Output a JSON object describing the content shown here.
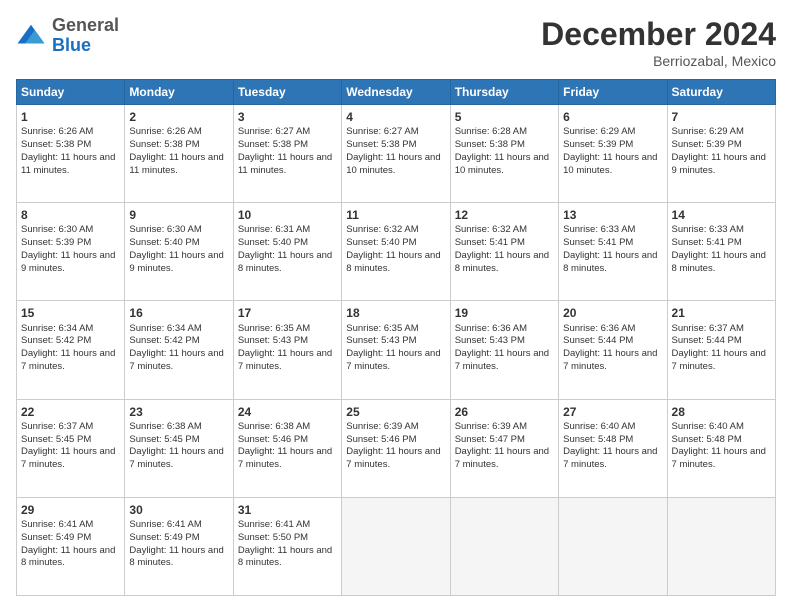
{
  "logo": {
    "general": "General",
    "blue": "Blue"
  },
  "header": {
    "month": "December 2024",
    "location": "Berriozabal, Mexico"
  },
  "weekdays": [
    "Sunday",
    "Monday",
    "Tuesday",
    "Wednesday",
    "Thursday",
    "Friday",
    "Saturday"
  ],
  "weeks": [
    [
      {
        "day": 1,
        "sunrise": "6:26 AM",
        "sunset": "5:38 PM",
        "daylight": "11 hours and 11 minutes."
      },
      {
        "day": 2,
        "sunrise": "6:26 AM",
        "sunset": "5:38 PM",
        "daylight": "11 hours and 11 minutes."
      },
      {
        "day": 3,
        "sunrise": "6:27 AM",
        "sunset": "5:38 PM",
        "daylight": "11 hours and 11 minutes."
      },
      {
        "day": 4,
        "sunrise": "6:27 AM",
        "sunset": "5:38 PM",
        "daylight": "11 hours and 10 minutes."
      },
      {
        "day": 5,
        "sunrise": "6:28 AM",
        "sunset": "5:38 PM",
        "daylight": "11 hours and 10 minutes."
      },
      {
        "day": 6,
        "sunrise": "6:29 AM",
        "sunset": "5:39 PM",
        "daylight": "11 hours and 10 minutes."
      },
      {
        "day": 7,
        "sunrise": "6:29 AM",
        "sunset": "5:39 PM",
        "daylight": "11 hours and 9 minutes."
      }
    ],
    [
      {
        "day": 8,
        "sunrise": "6:30 AM",
        "sunset": "5:39 PM",
        "daylight": "11 hours and 9 minutes."
      },
      {
        "day": 9,
        "sunrise": "6:30 AM",
        "sunset": "5:40 PM",
        "daylight": "11 hours and 9 minutes."
      },
      {
        "day": 10,
        "sunrise": "6:31 AM",
        "sunset": "5:40 PM",
        "daylight": "11 hours and 8 minutes."
      },
      {
        "day": 11,
        "sunrise": "6:32 AM",
        "sunset": "5:40 PM",
        "daylight": "11 hours and 8 minutes."
      },
      {
        "day": 12,
        "sunrise": "6:32 AM",
        "sunset": "5:41 PM",
        "daylight": "11 hours and 8 minutes."
      },
      {
        "day": 13,
        "sunrise": "6:33 AM",
        "sunset": "5:41 PM",
        "daylight": "11 hours and 8 minutes."
      },
      {
        "day": 14,
        "sunrise": "6:33 AM",
        "sunset": "5:41 PM",
        "daylight": "11 hours and 8 minutes."
      }
    ],
    [
      {
        "day": 15,
        "sunrise": "6:34 AM",
        "sunset": "5:42 PM",
        "daylight": "11 hours and 7 minutes."
      },
      {
        "day": 16,
        "sunrise": "6:34 AM",
        "sunset": "5:42 PM",
        "daylight": "11 hours and 7 minutes."
      },
      {
        "day": 17,
        "sunrise": "6:35 AM",
        "sunset": "5:43 PM",
        "daylight": "11 hours and 7 minutes."
      },
      {
        "day": 18,
        "sunrise": "6:35 AM",
        "sunset": "5:43 PM",
        "daylight": "11 hours and 7 minutes."
      },
      {
        "day": 19,
        "sunrise": "6:36 AM",
        "sunset": "5:43 PM",
        "daylight": "11 hours and 7 minutes."
      },
      {
        "day": 20,
        "sunrise": "6:36 AM",
        "sunset": "5:44 PM",
        "daylight": "11 hours and 7 minutes."
      },
      {
        "day": 21,
        "sunrise": "6:37 AM",
        "sunset": "5:44 PM",
        "daylight": "11 hours and 7 minutes."
      }
    ],
    [
      {
        "day": 22,
        "sunrise": "6:37 AM",
        "sunset": "5:45 PM",
        "daylight": "11 hours and 7 minutes."
      },
      {
        "day": 23,
        "sunrise": "6:38 AM",
        "sunset": "5:45 PM",
        "daylight": "11 hours and 7 minutes."
      },
      {
        "day": 24,
        "sunrise": "6:38 AM",
        "sunset": "5:46 PM",
        "daylight": "11 hours and 7 minutes."
      },
      {
        "day": 25,
        "sunrise": "6:39 AM",
        "sunset": "5:46 PM",
        "daylight": "11 hours and 7 minutes."
      },
      {
        "day": 26,
        "sunrise": "6:39 AM",
        "sunset": "5:47 PM",
        "daylight": "11 hours and 7 minutes."
      },
      {
        "day": 27,
        "sunrise": "6:40 AM",
        "sunset": "5:48 PM",
        "daylight": "11 hours and 7 minutes."
      },
      {
        "day": 28,
        "sunrise": "6:40 AM",
        "sunset": "5:48 PM",
        "daylight": "11 hours and 7 minutes."
      }
    ],
    [
      {
        "day": 29,
        "sunrise": "6:41 AM",
        "sunset": "5:49 PM",
        "daylight": "11 hours and 8 minutes."
      },
      {
        "day": 30,
        "sunrise": "6:41 AM",
        "sunset": "5:49 PM",
        "daylight": "11 hours and 8 minutes."
      },
      {
        "day": 31,
        "sunrise": "6:41 AM",
        "sunset": "5:50 PM",
        "daylight": "11 hours and 8 minutes."
      },
      null,
      null,
      null,
      null
    ]
  ],
  "labels": {
    "sunrise": "Sunrise:",
    "sunset": "Sunset:",
    "daylight": "Daylight:"
  }
}
